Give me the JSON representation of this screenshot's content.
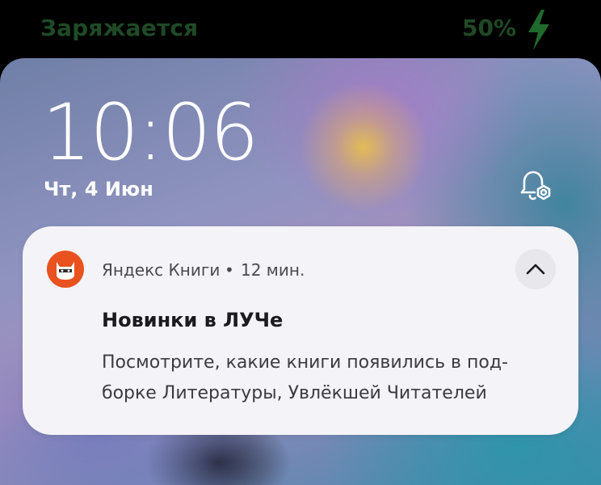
{
  "status_bar": {
    "charging_label": "Заряжается",
    "battery_percent": "50%",
    "battery_level": 0.5,
    "charge_icon": "lightning-bolt-icon",
    "text_color": "#1e4a26"
  },
  "lockscreen": {
    "time": "10:06",
    "date": "Чт, 4 Июн",
    "alarm_icon": "alarm-settings-icon"
  },
  "notification": {
    "app_name": "Яндекс Книги",
    "separator": "•",
    "time_ago": "12 мин.",
    "app_icon": "yandex-books-cat-icon",
    "app_icon_color": "#e9511e",
    "collapse_icon": "chevron-up-icon",
    "title": "Новинки в ЛУЧе",
    "body_lines": [
      "Посмотрите, какие книги появились в под-",
      "борке Литературы, Увлёкшей Читателей"
    ]
  }
}
